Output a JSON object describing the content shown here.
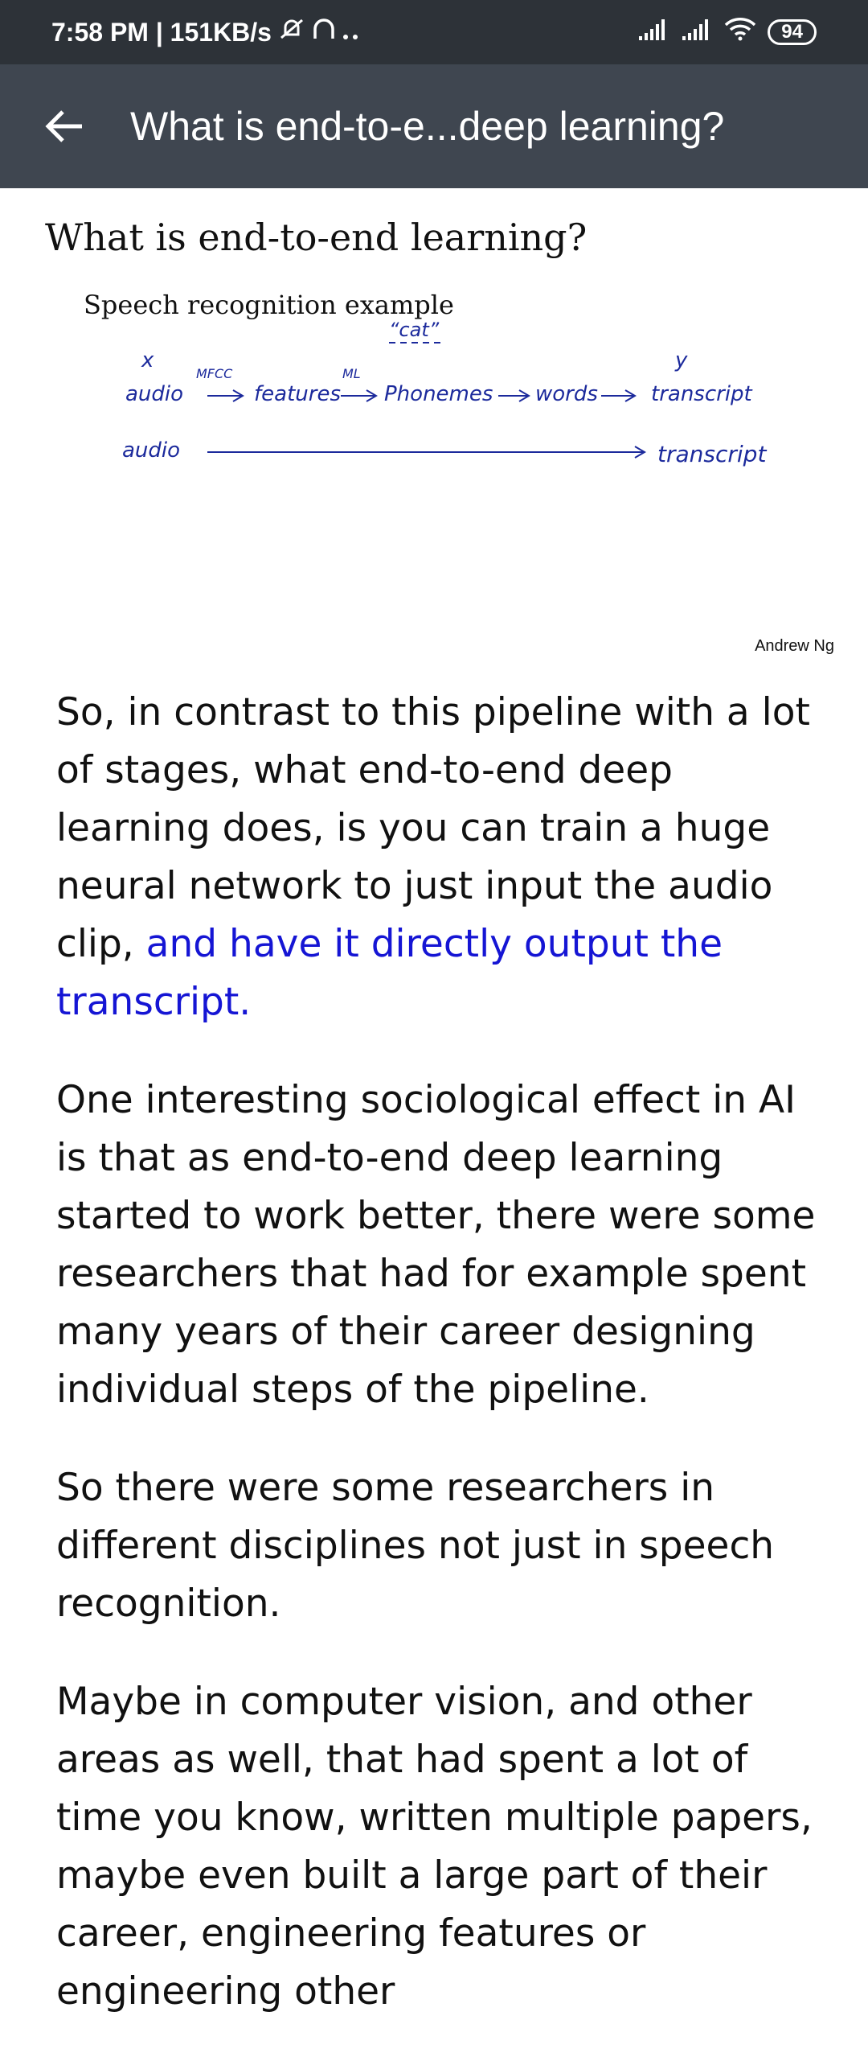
{
  "status_bar": {
    "time_speed": "7:58 PM | 151KB/s",
    "icons": [
      "mute-icon",
      "headphones-icon",
      "more-dots-icon",
      "signal-icon",
      "signal-icon",
      "wifi-icon"
    ],
    "battery": "94"
  },
  "app_bar": {
    "title": "What is end-to-e...deep learning?",
    "back_icon": "arrow-left-icon"
  },
  "slide": {
    "title": "What is end-to-end learning?",
    "subtitle": "Speech recognition example",
    "credit": "Andrew Ng",
    "handwriting": {
      "cat": "“cat”",
      "x": "x",
      "y": "y",
      "mfcc": "MFCC",
      "ml": "ML",
      "audio1": "audio",
      "features": "features",
      "phonemes": "Phonemes",
      "words": "words",
      "transcript1": "transcript",
      "audio2": "audio",
      "transcript2": "transcript"
    },
    "ink_color": "#1c2a9c"
  },
  "transcript": {
    "p1_normal": "So, in contrast to this pipeline with a lot of stages, what end-to-end deep learning does, is you can train a huge neural network to just input the audio clip, ",
    "p1_highlight": "and have it directly output the transcript.",
    "p2": "One interesting sociological effect in AI is that as end-to-end deep learning started to work better, there were some researchers that had for example spent many years of their career designing individual steps of the pipeline.",
    "p3": "So there were some researchers in different disciplines not just in speech recognition.",
    "p4": "Maybe in computer vision, and other areas as well, that had spent a lot of time you know, written multiple papers, maybe even built a large part of their career, engineering features or engineering other"
  },
  "colors": {
    "status_bar": "#2d3238",
    "app_bar": "#3f4650",
    "highlight": "#1515d4"
  }
}
